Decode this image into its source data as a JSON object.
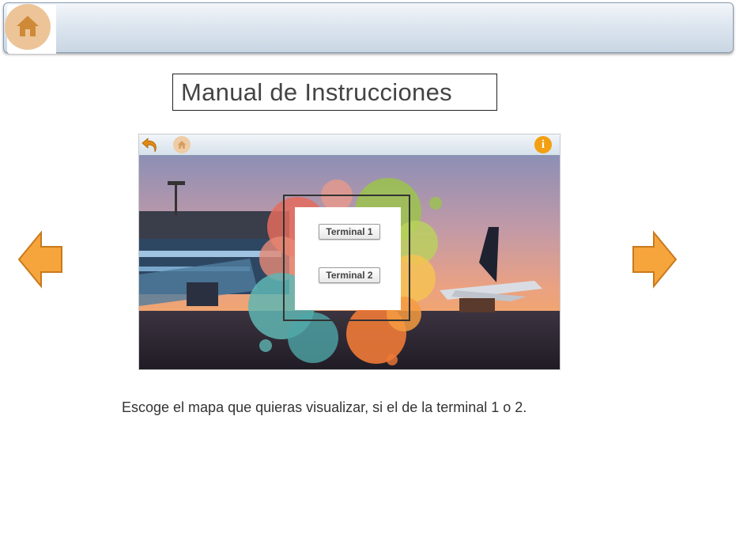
{
  "header": {
    "home_icon": "home-icon"
  },
  "title": "Manual de Instrucciones",
  "preview": {
    "toolbar": {
      "back_icon": "back-arrow-icon",
      "home_icon": "home-icon",
      "info_icon": "info-icon",
      "info_glyph": "i"
    },
    "buttons": {
      "terminal_1": "Terminal 1",
      "terminal_2": "Terminal 2"
    }
  },
  "navigation": {
    "prev_icon": "left-arrow-icon",
    "next_icon": "right-arrow-icon"
  },
  "caption": "Escoge el mapa que quieras visualizar, si el de la terminal 1 o 2.",
  "colors": {
    "accent_orange": "#f6a43c",
    "home_circle": "#ecc498",
    "info_orange": "#f2a012"
  }
}
